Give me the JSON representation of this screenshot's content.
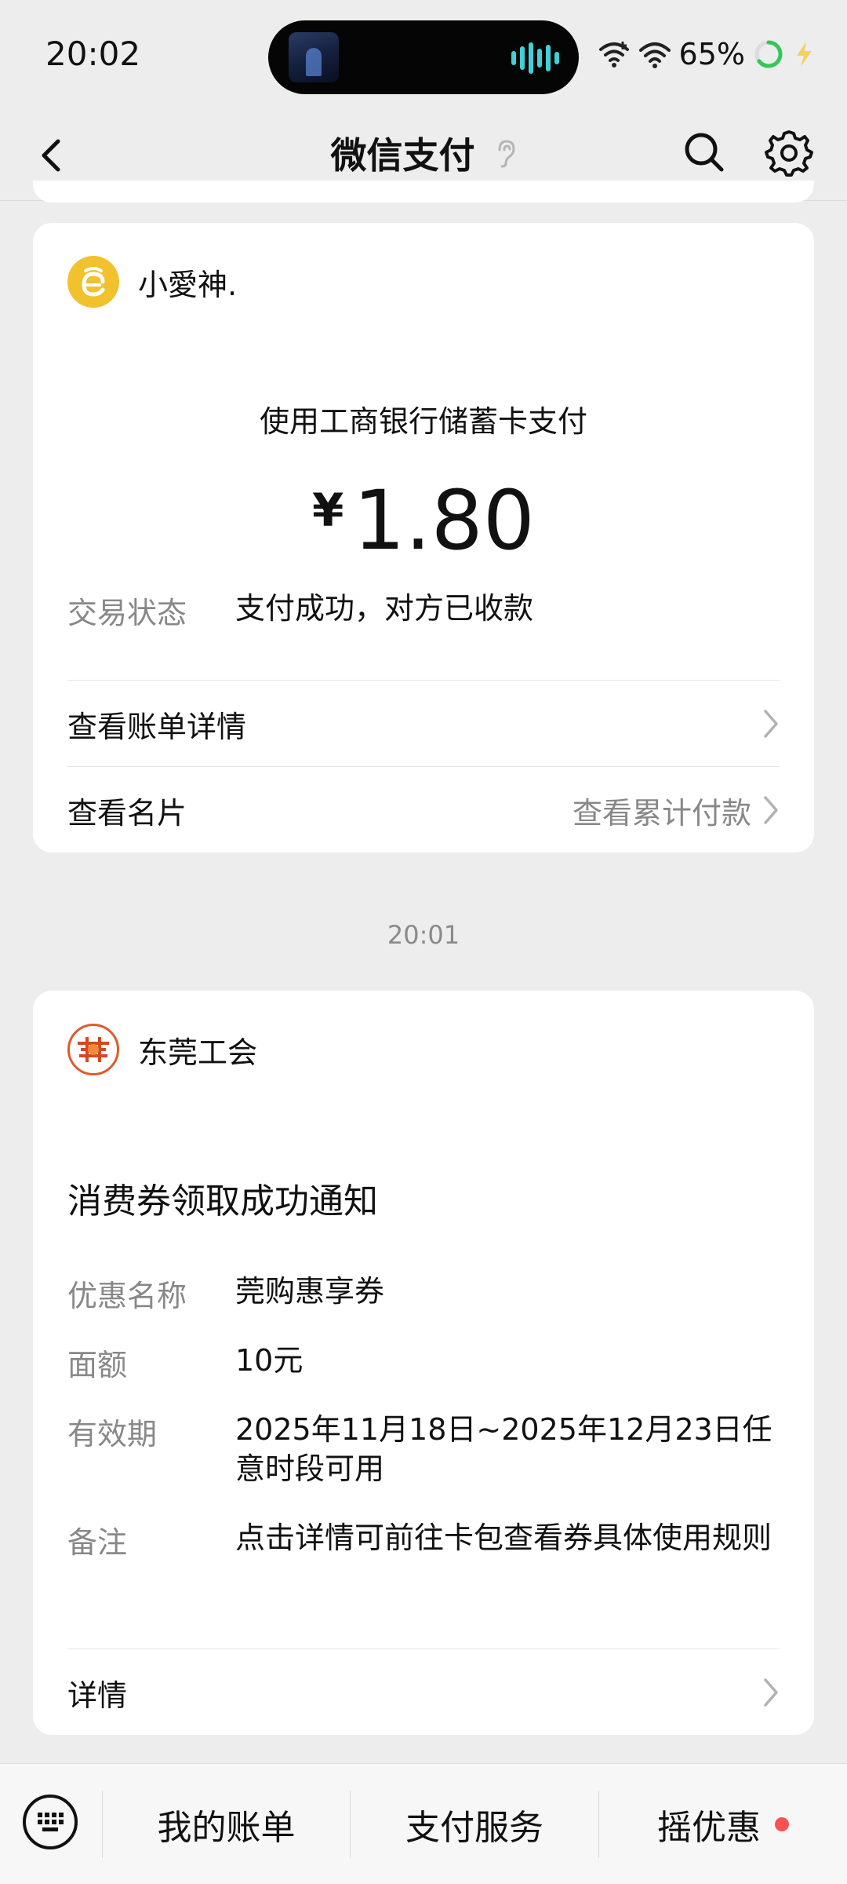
{
  "status_bar": {
    "time": "20:02",
    "battery_percent": "65%",
    "battery_level": 0.65
  },
  "nav": {
    "title": "微信支付"
  },
  "payment_card": {
    "merchant": "小愛神.",
    "method": "使用工商银行储蓄卡支付",
    "currency_symbol": "¥",
    "amount": "1.80",
    "status_label": "交易状态",
    "status_value": "支付成功，对方已收款",
    "link_bill": "查看账单详情",
    "link_card": "查看名片",
    "link_total": "查看累计付款"
  },
  "timestamp": "20:01",
  "notice_card": {
    "sender": "东莞工会",
    "title": "消费券领取成功通知",
    "fields": [
      {
        "label": "优惠名称",
        "value": "莞购惠享券"
      },
      {
        "label": "面额",
        "value": "10元"
      },
      {
        "label": "有效期",
        "value": "2025年11月18日~2025年12月23日任意时段可用"
      },
      {
        "label": "备注",
        "value": "点击详情可前往卡包查看券具体使用规则"
      }
    ],
    "details_label": "详情"
  },
  "bottom_menu": {
    "items": [
      "我的账单",
      "支付服务",
      "摇优惠"
    ]
  },
  "colors": {
    "background": "#ededed",
    "card": "#ffffff",
    "secondary_text": "#888888",
    "badge_red": "#fa5151",
    "avatar_yellow": "#f2c12e",
    "battery_green": "#34c759"
  }
}
